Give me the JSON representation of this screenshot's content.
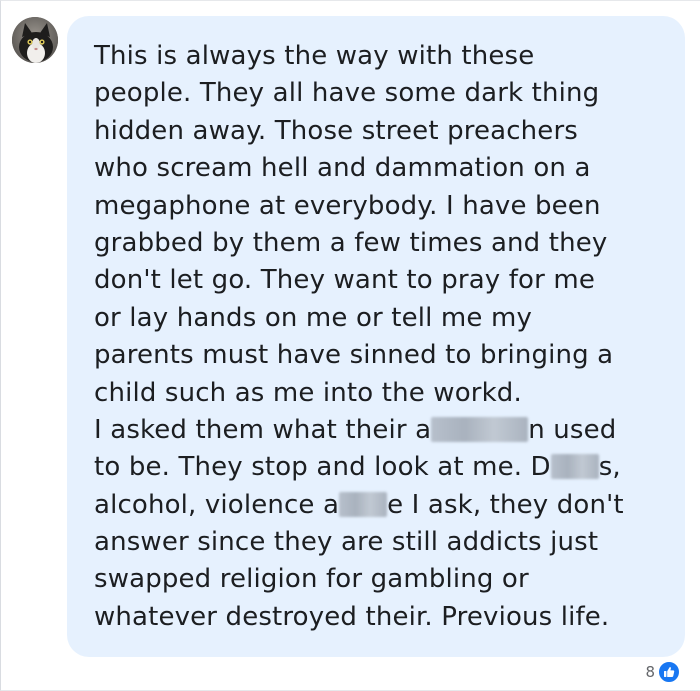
{
  "comment": {
    "avatar_icon": "cat-avatar-icon",
    "lines": [
      [
        "This is always the way with these"
      ],
      [
        "people. They all have some dark thing"
      ],
      [
        "hidden away. Those street preachers"
      ],
      [
        "who scream hell and dammation on a"
      ],
      [
        "megaphone at everybody. I have been"
      ],
      [
        "grabbed by them a few times and they"
      ],
      [
        "don't let go. They want to pray for me"
      ],
      [
        "or lay hands on me or tell me my"
      ],
      [
        "parents must have sinned to bringing a"
      ],
      [
        "child such as me into the workd."
      ],
      [
        "I asked them what their a",
        "n used"
      ],
      [
        "to be. They stop and look at me. D",
        "s,"
      ],
      [
        "alcohol, violence a",
        "e I ask, they don't"
      ],
      [
        "answer since they are still addicts just"
      ],
      [
        "swapped religion for gambling or"
      ],
      [
        "whatever destroyed their. Previous life."
      ]
    ],
    "reaction_count": "8",
    "reaction_icon": "like-thumbs-up-icon",
    "colors": {
      "bubble_background": "#e6f1fe",
      "text": "#1c1e21",
      "like_badge": "#1877f2",
      "redaction_blur": "#b0b9c5"
    }
  }
}
